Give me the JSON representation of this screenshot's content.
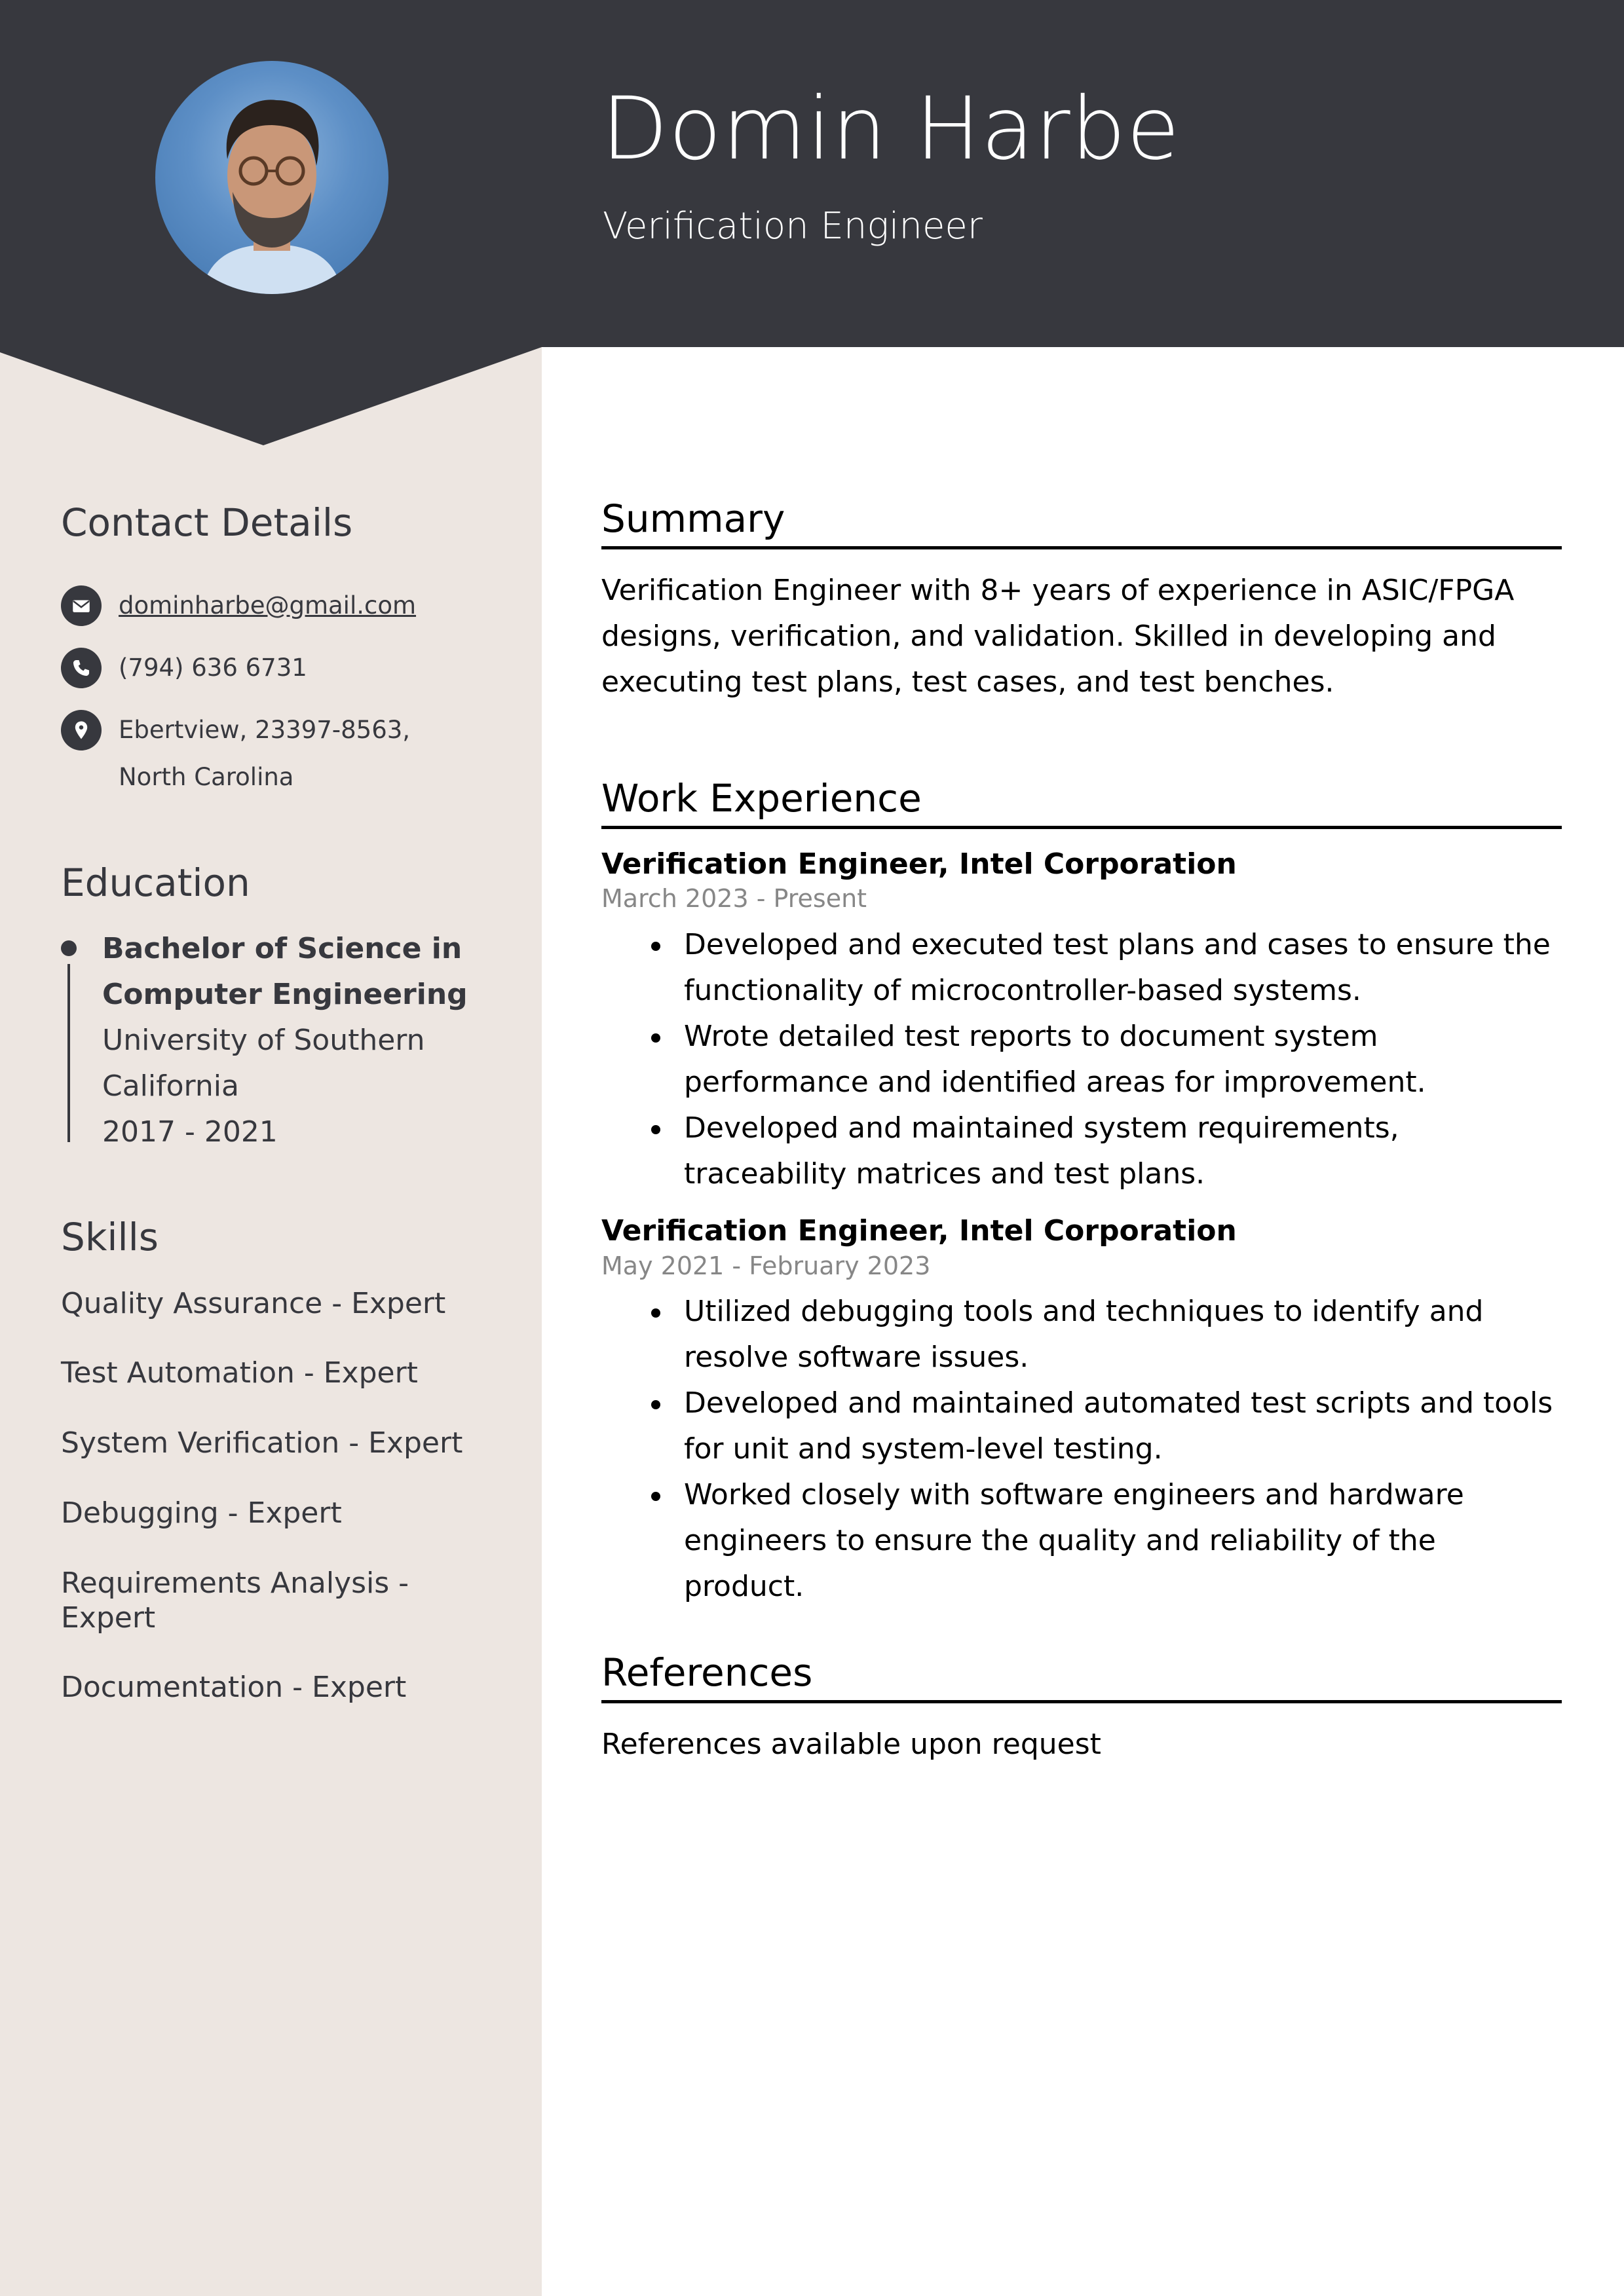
{
  "colors": {
    "header_bg": "#37383e",
    "sidebar_bg": "#ede6e1",
    "text_dark": "#37383e",
    "date_gray": "#878787"
  },
  "header": {
    "name": "Domin Harbe",
    "title": "Verification Engineer",
    "photo": "profile-photo"
  },
  "sidebar": {
    "contact": {
      "heading": "Contact Details",
      "items": [
        {
          "icon": "envelope-icon",
          "text": "dominharbe@gmail.com"
        },
        {
          "icon": "phone-icon",
          "text": "(794) 636 6731"
        },
        {
          "icon": "map-pin-icon",
          "text": "Ebertview, 23397-8563, North Carolina"
        }
      ]
    },
    "education": {
      "heading": "Education",
      "items": [
        {
          "degree": "Bachelor of Science in Computer Engineering",
          "school": "University of Southern California",
          "years": "2017 - 2021"
        }
      ]
    },
    "skills": {
      "heading": "Skills",
      "items": [
        "Quality Assurance - Expert",
        "Test Automation - Expert",
        "System Verification - Expert",
        "Debugging - Expert",
        "Requirements Analysis - Expert",
        "Documentation - Expert"
      ]
    }
  },
  "main": {
    "summary": {
      "heading": "Summary",
      "text": "Verification Engineer with 8+ years of experience in ASIC/FPGA designs, verification, and validation. Skilled in developing and executing test plans, test cases, and test benches."
    },
    "experience": {
      "heading": "Work Experience",
      "jobs": [
        {
          "title": "Verification Engineer, Intel Corporation",
          "dates": "March 2023 - Present",
          "bullets": [
            "Developed and executed test plans and cases to ensure the functionality of microcontroller-based systems.",
            "Wrote detailed test reports to document system performance and identified areas for improvement.",
            "Developed and maintained system requirements, traceability matrices and test plans."
          ]
        },
        {
          "title": "Verification Engineer, Intel Corporation",
          "dates": "May 2021 - February 2023",
          "bullets": [
            "Utilized debugging tools and techniques to identify and resolve software issues.",
            "Developed and maintained automated test scripts and tools for unit and system-level testing.",
            "Worked closely with software engineers and hardware engineers to ensure the quality and reliability of the product."
          ]
        }
      ]
    },
    "references": {
      "heading": "References",
      "text": "References available upon request"
    }
  }
}
